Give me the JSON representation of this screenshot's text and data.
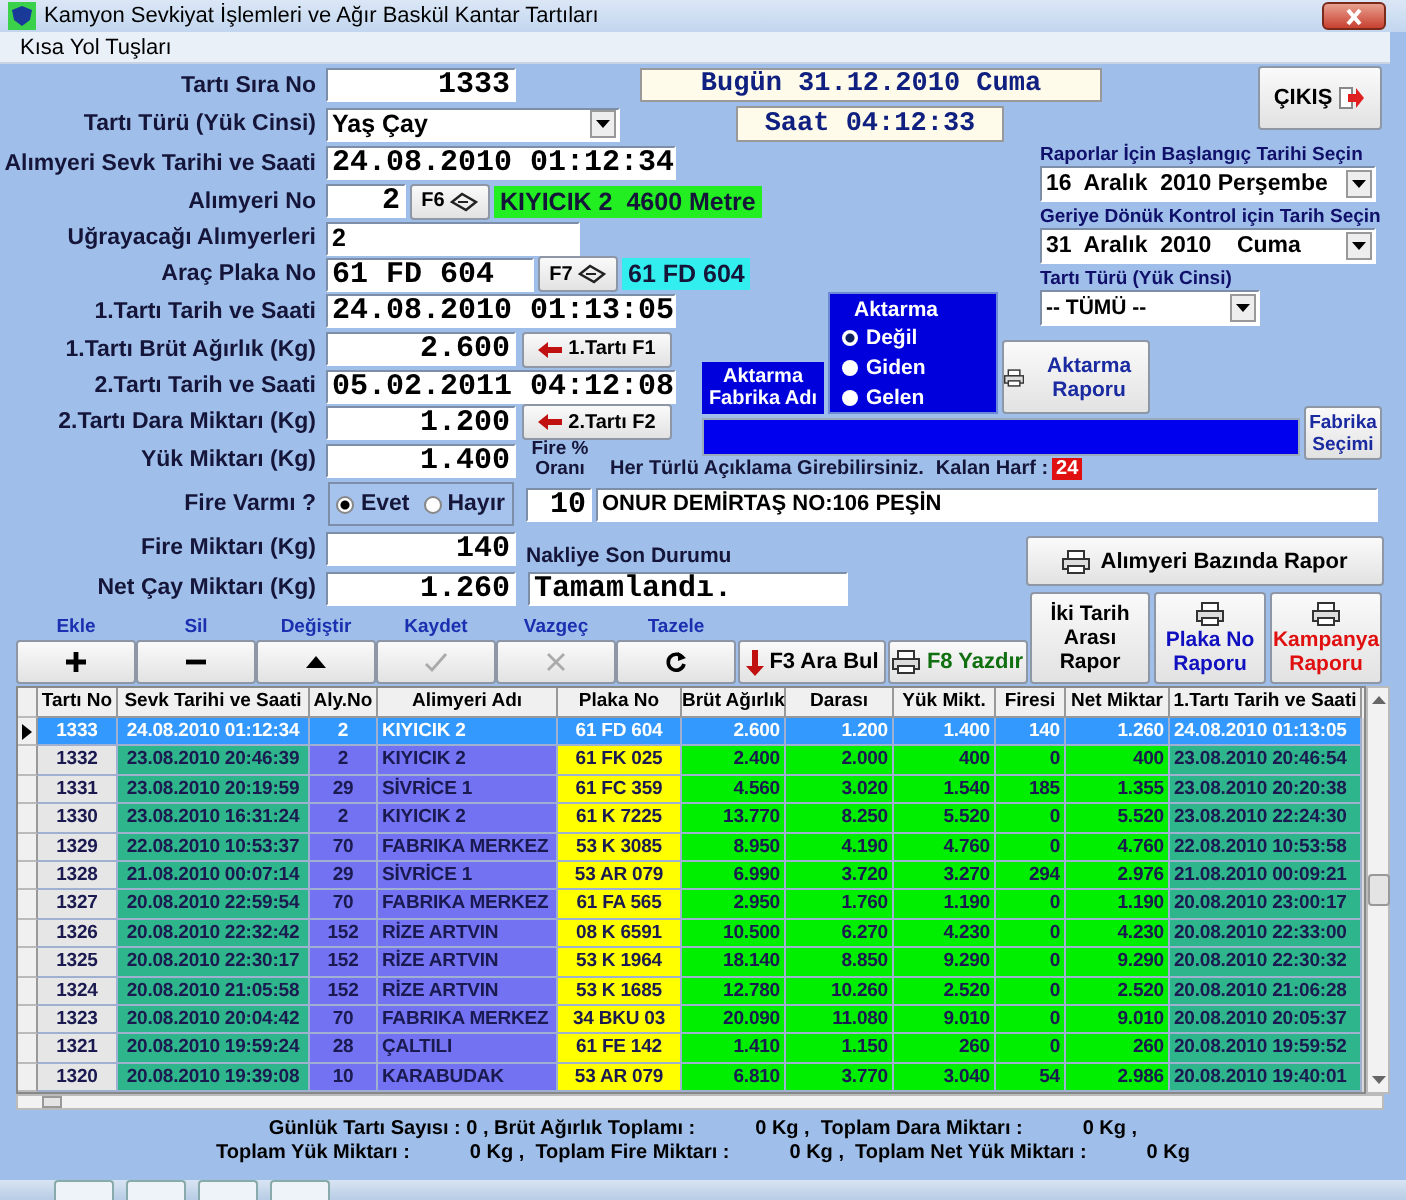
{
  "window": {
    "title": "Kamyon Sevkiyat İşlemleri ve Ağır Baskül Kantar Tartıları"
  },
  "menu": [
    "Kısa Yol Tuşları"
  ],
  "header": {
    "today": "Bugün 31.12.2010 Cuma",
    "time": "Saat 04:12:33",
    "exit_button": "ÇIKIŞ"
  },
  "fields": [
    {
      "label": "Tartı Sıra No",
      "value": "1333",
      "kind": "mono"
    },
    {
      "label": "Tartı Türü (Yük Cinsi)",
      "value": "Yaş Çay",
      "kind": "select"
    },
    {
      "label": "Alımyeri Sevk Tarihi ve Saati",
      "value": "24.08.2010 01:12:34",
      "kind": "mono"
    },
    {
      "label": "Alımyeri No",
      "value": "2",
      "kind": "lookup",
      "key": "F6",
      "tag": "KIYICIK 2  4600 Metre",
      "color": "#22ee22"
    },
    {
      "label": "Uğrayacağı Alımyerleri",
      "value": "2",
      "kind": "sans"
    },
    {
      "label": "Araç Plaka No",
      "value": "61 FD 604",
      "kind": "lookup",
      "key": "F7",
      "tag": "61 FD 604",
      "color": "#33eeee"
    },
    {
      "label": "1.Tartı Tarih ve Saati",
      "value": "24.08.2010 01:13:05",
      "kind": "mono"
    },
    {
      "label": "1.Tartı Brüt Ağırlık (Kg)",
      "value": "2.600",
      "kind": "weigh",
      "button": "1.Tartı F1"
    },
    {
      "label": "2.Tartı Tarih ve Saati",
      "value": "05.02.2011 04:12:08",
      "kind": "mono"
    },
    {
      "label": "2.Tartı Dara Miktarı (Kg)",
      "value": "1.200",
      "kind": "weigh",
      "button": "2.Tartı F2"
    },
    {
      "label": "Yük Miktarı (Kg)",
      "value": "1.400",
      "kind": "mono"
    },
    {
      "label": "Fire Varmı ?",
      "kind": "radio",
      "options": [
        {
          "label": "Evet",
          "selected": true
        },
        {
          "label": "Hayır",
          "selected": false
        }
      ]
    },
    {
      "label": "Fire Miktarı (Kg)",
      "value": "140",
      "kind": "mono"
    },
    {
      "label": "Net Çay Miktarı (Kg)",
      "value": "1.260",
      "kind": "mono"
    }
  ],
  "fire_rate": {
    "label": "Fire % Oranı",
    "value": "10"
  },
  "description": {
    "label": "Her Türlü Açıklama Girebilirsiniz.",
    "remaining_label": "Kalan Harf :",
    "remaining": "24",
    "value": "ONUR DEMİRTAŞ NO:106 PEŞİN"
  },
  "transport_status": {
    "label": "Nakliye Son Durumu",
    "value": "Tamamlandı."
  },
  "report_filters": [
    {
      "label": "Raporlar İçin Başlangıç Tarihi Seçin",
      "value": "16  Aralık  2010 Perşembe"
    },
    {
      "label": "Geriye Dönük Kontrol için Tarih Seçin",
      "value": "31  Aralık  2010    Cuma"
    },
    {
      "label": "Tartı Türü (Yük Cinsi)",
      "value": "-- TÜMÜ --"
    }
  ],
  "aktarma": {
    "title": "Aktarma",
    "options": [
      {
        "label": "Değil",
        "selected": true
      },
      {
        "label": "Giden",
        "selected": false
      },
      {
        "label": "Gelen",
        "selected": false
      }
    ],
    "factory_label": "Aktarma Fabrika Adı",
    "report_button": "Aktarma Raporu",
    "factory_button": "Fabrika Seçimi"
  },
  "report_buttons": [
    {
      "label": "Alımyeri Bazında Rapor",
      "kind": "wide",
      "color": "#000000"
    },
    {
      "label": "İki Tarih Arası Rapor",
      "kind": "plain",
      "color": "#000000"
    },
    {
      "label": "Plaka No Raporu",
      "kind": "print",
      "color": "#1010c0"
    },
    {
      "label": "Kampanya Raporu",
      "kind": "print",
      "color": "#e01010"
    }
  ],
  "toolbar": [
    {
      "caption": "Ekle",
      "kind": "add",
      "disabled": false
    },
    {
      "caption": "Sil",
      "kind": "delete",
      "disabled": false
    },
    {
      "caption": "Değiştir",
      "kind": "edit",
      "disabled": false
    },
    {
      "caption": "Kaydet",
      "kind": "save",
      "disabled": true
    },
    {
      "caption": "Vazgeç",
      "kind": "cancel",
      "disabled": true
    },
    {
      "caption": "Tazele",
      "kind": "refresh",
      "disabled": false
    }
  ],
  "action_buttons": [
    {
      "label": "F3 Ara Bul",
      "kind": "search"
    },
    {
      "label": "F8 Yazdır",
      "kind": "print"
    }
  ],
  "table": {
    "columns": [
      "Tartı No",
      "Sevk Tarihi ve Saati",
      "Aly.No",
      "Alimyeri Adı",
      "Plaka No",
      "Brüt Ağırlık",
      "Darası",
      "Yük Mikt.",
      "Firesi",
      "Net Miktar",
      "1.Tartı Tarih ve Saati"
    ],
    "rows": [
      {
        "selected": true,
        "cells": [
          "1333",
          "24.08.2010 01:12:34",
          "2",
          "KIYICIK 2",
          "61 FD 604",
          "2.600",
          "1.200",
          "1.400",
          "140",
          "1.260",
          "24.08.2010 01:13:05"
        ]
      },
      {
        "selected": false,
        "cells": [
          "1332",
          "23.08.2010 20:46:39",
          "2",
          "KIYICIK 2",
          "61 FK 025",
          "2.400",
          "2.000",
          "400",
          "0",
          "400",
          "23.08.2010 20:46:54"
        ]
      },
      {
        "selected": false,
        "cells": [
          "1331",
          "23.08.2010 20:19:59",
          "29",
          "SİVRİCE 1",
          "61 FC 359",
          "4.560",
          "3.020",
          "1.540",
          "185",
          "1.355",
          "23.08.2010 20:20:38"
        ]
      },
      {
        "selected": false,
        "cells": [
          "1330",
          "23.08.2010 16:31:24",
          "2",
          "KIYICIK 2",
          "61 K 7225",
          "13.770",
          "8.250",
          "5.520",
          "0",
          "5.520",
          "23.08.2010 22:24:30"
        ]
      },
      {
        "selected": false,
        "cells": [
          "1329",
          "22.08.2010 10:53:37",
          "70",
          "FABRIKA MERKEZ",
          "53 K 3085",
          "8.950",
          "4.190",
          "4.760",
          "0",
          "4.760",
          "22.08.2010 10:53:58"
        ]
      },
      {
        "selected": false,
        "cells": [
          "1328",
          "21.08.2010 00:07:14",
          "29",
          "SİVRİCE 1",
          "53 AR 079",
          "6.990",
          "3.720",
          "3.270",
          "294",
          "2.976",
          "21.08.2010 00:09:21"
        ]
      },
      {
        "selected": false,
        "cells": [
          "1327",
          "20.08.2010 22:59:54",
          "70",
          "FABRIKA MERKEZ",
          "61 FA 565",
          "2.950",
          "1.760",
          "1.190",
          "0",
          "1.190",
          "20.08.2010 23:00:17"
        ]
      },
      {
        "selected": false,
        "cells": [
          "1326",
          "20.08.2010 22:32:42",
          "152",
          "RİZE ARTVIN",
          "08 K 6591",
          "10.500",
          "6.270",
          "4.230",
          "0",
          "4.230",
          "20.08.2010 22:33:00"
        ]
      },
      {
        "selected": false,
        "cells": [
          "1325",
          "20.08.2010 22:30:17",
          "152",
          "RİZE ARTVIN",
          "53 K 1964",
          "18.140",
          "8.850",
          "9.290",
          "0",
          "9.290",
          "20.08.2010 22:30:32"
        ]
      },
      {
        "selected": false,
        "cells": [
          "1324",
          "20.08.2010 21:05:58",
          "152",
          "RİZE ARTVIN",
          "53 K 1685",
          "12.780",
          "10.260",
          "2.520",
          "0",
          "2.520",
          "20.08.2010 21:06:28"
        ]
      },
      {
        "selected": false,
        "cells": [
          "1323",
          "20.08.2010 20:04:42",
          "70",
          "FABRIKA MERKEZ",
          "34 BKU 03",
          "20.090",
          "11.080",
          "9.010",
          "0",
          "9.010",
          "20.08.2010 20:05:37"
        ]
      },
      {
        "selected": false,
        "cells": [
          "1321",
          "20.08.2010 19:59:24",
          "28",
          "ÇALTILI",
          "61 FE 142",
          "1.410",
          "1.150",
          "260",
          "0",
          "260",
          "20.08.2010 19:59:52"
        ]
      },
      {
        "selected": false,
        "cells": [
          "1320",
          "20.08.2010 19:39:08",
          "10",
          "KARABUDAK",
          "53 AR 079",
          "6.810",
          "3.770",
          "3.040",
          "54",
          "2.986",
          "20.08.2010 19:40:01"
        ]
      }
    ]
  },
  "summary": [
    [
      "Günlük Tartı Sayısı : 0 , Brüt Ağırlık Toplamı :",
      "0 Kg ,  Toplam Dara Miktarı :",
      "0 Kg ,"
    ],
    [
      "Toplam Yük Miktarı :",
      "0 Kg ,  Toplam Fire Miktarı :",
      "0 Kg ,  Toplam Net Yük Miktarı :",
      "0 Kg"
    ]
  ]
}
